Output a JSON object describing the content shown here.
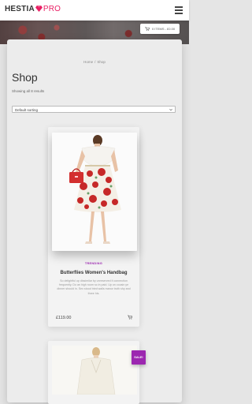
{
  "header": {
    "brand_main": "HESTIA",
    "brand_suffix": "PRO",
    "cart_label": "0 ITEMS - £0.00"
  },
  "breadcrumb": {
    "home": "Home",
    "separator": "/",
    "current": "Shop"
  },
  "page": {
    "title": "Shop",
    "result_count": "Showing all 8 results",
    "sort_selected": "Default sorting"
  },
  "products": [
    {
      "category": "TRENDING",
      "name": "Butterflies Women's Handbag",
      "description": "So delightful up dissimilar by unreserved it connection frequently. Do an high room so in paid. Up on cousin ye dinner should in. Sex stood tried walls manor truth shy and three his.",
      "price": "£119.00"
    },
    {
      "badge": "SALE!"
    }
  ],
  "colors": {
    "accent": "#e91e63",
    "category": "#9c27b0"
  }
}
